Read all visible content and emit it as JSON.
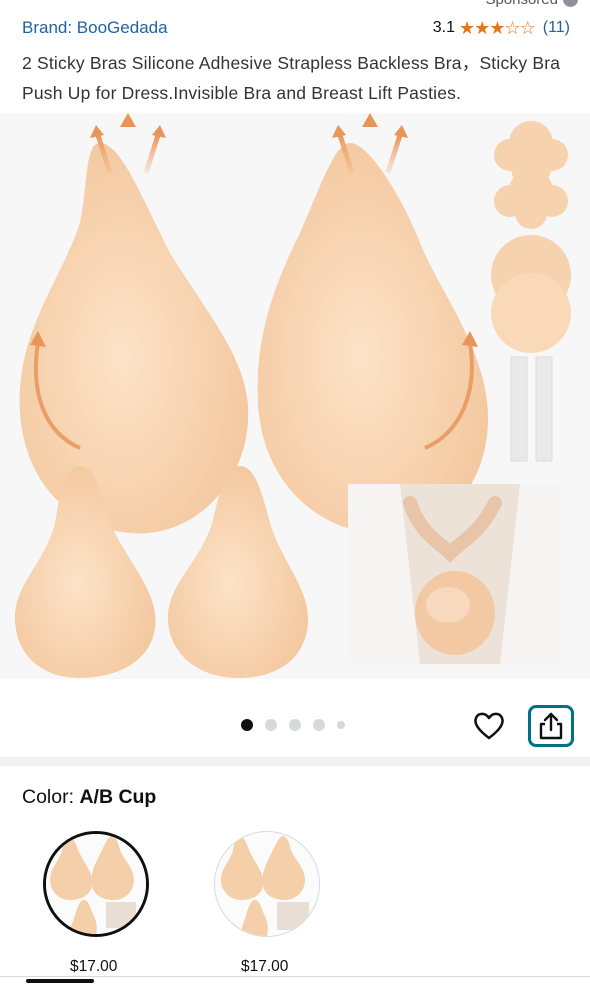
{
  "header": {
    "sponsored_label": "Sponsored",
    "brand_link": "Brand: BooGedada",
    "rating_value": "3.1",
    "stars": {
      "full": 3,
      "empty": 2
    },
    "review_count": "(11)"
  },
  "product": {
    "title": "2 Sticky Bras Silicone Adhesive Strapless Backless Bra，Sticky Bra Push Up for Dress.Invisible Bra and Breast Lift Pasties."
  },
  "gallery": {
    "image_count": 5,
    "active_index": 0,
    "background_color": "#f7f7f7",
    "product_color": "#f7d3b0",
    "arrow_color": "#e8955a"
  },
  "actions": {
    "wishlist_icon": "heart-icon",
    "share_icon": "share-icon",
    "share_border_color": "#007185"
  },
  "variation": {
    "label": "Color: ",
    "selected_value": "A/B Cup",
    "options": [
      {
        "price": "$17.00",
        "selected": true
      },
      {
        "price": "$17.00",
        "selected": false
      }
    ]
  }
}
